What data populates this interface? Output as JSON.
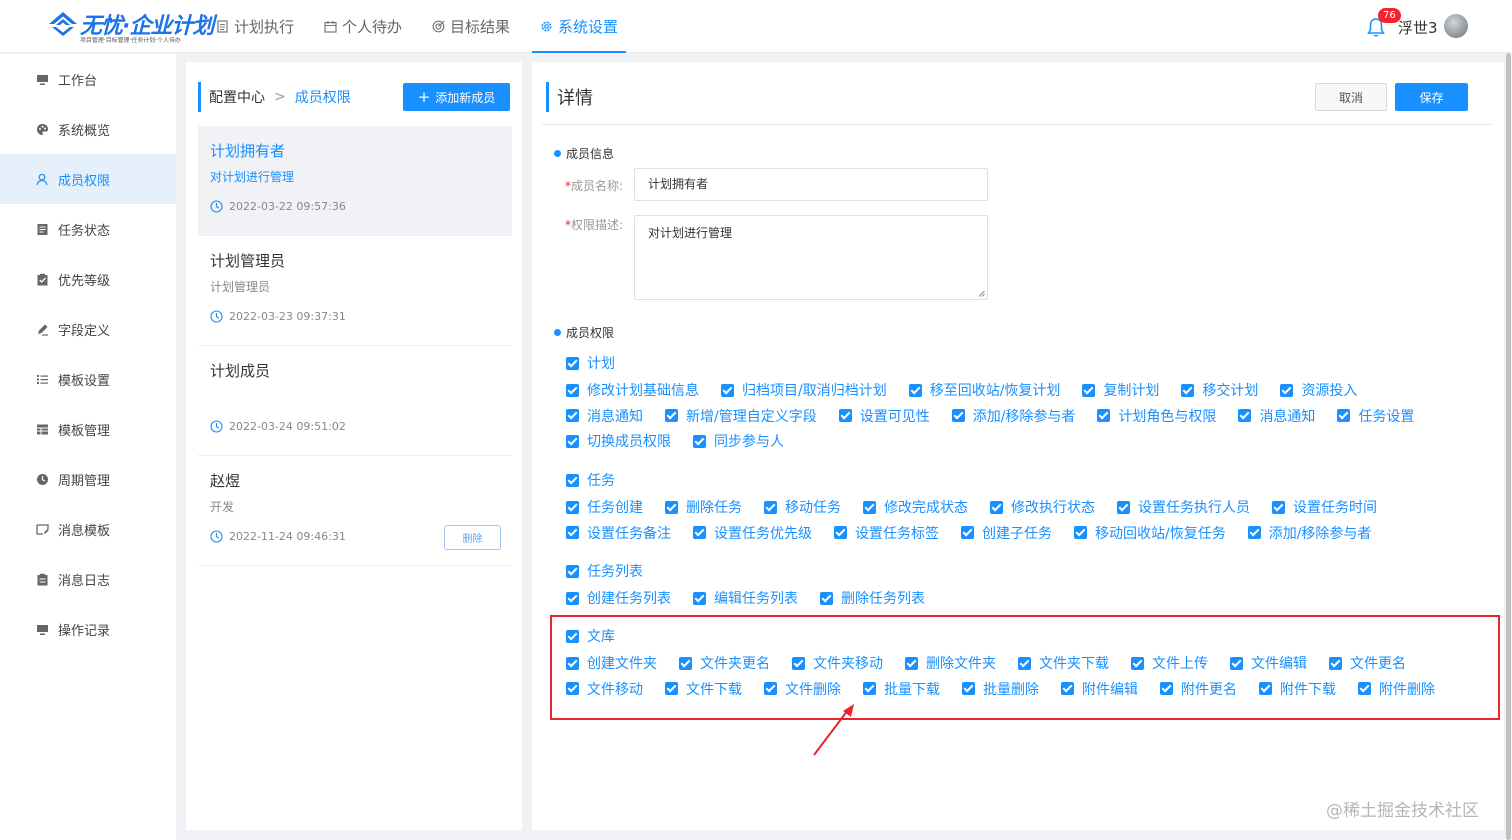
{
  "header": {
    "logo_title": "无忧·企业计划",
    "logo_subtitle": "项目管理·目标管理·任务计划·个人待办",
    "nav": [
      {
        "label": "计划执行",
        "icon": "document-icon",
        "active": false
      },
      {
        "label": "个人待办",
        "icon": "calendar-icon",
        "active": false
      },
      {
        "label": "目标结果",
        "icon": "target-icon",
        "active": false
      },
      {
        "label": "系统设置",
        "icon": "gear-icon",
        "active": true
      }
    ],
    "notification_count": "76",
    "username": "浮世3"
  },
  "sidebar": {
    "items": [
      {
        "label": "工作台",
        "icon": "monitor-icon"
      },
      {
        "label": "系统概览",
        "icon": "palette-icon"
      },
      {
        "label": "成员权限",
        "icon": "user-icon"
      },
      {
        "label": "任务状态",
        "icon": "list-doc-icon"
      },
      {
        "label": "优先等级",
        "icon": "clipboard-check-icon"
      },
      {
        "label": "字段定义",
        "icon": "edit-icon"
      },
      {
        "label": "模板设置",
        "icon": "list-icon"
      },
      {
        "label": "模板管理",
        "icon": "table-icon"
      },
      {
        "label": "周期管理",
        "icon": "clock-icon"
      },
      {
        "label": "消息模板",
        "icon": "message-edit-icon"
      },
      {
        "label": "消息日志",
        "icon": "clipboard-icon"
      },
      {
        "label": "操作记录",
        "icon": "monitor-icon"
      }
    ],
    "active_index": 2
  },
  "middle": {
    "breadcrumb_root": "配置中心",
    "breadcrumb_current": "成员权限",
    "add_button": "添加新成员",
    "cards": [
      {
        "title": "计划拥有者",
        "desc": "对计划进行管理",
        "time": "2022-03-22 09:57:36",
        "active": true
      },
      {
        "title": "计划管理员",
        "desc": "计划管理员",
        "time": "2022-03-23 09:37:31",
        "active": false
      },
      {
        "title": "计划成员",
        "desc": "",
        "time": "2022-03-24 09:51:02",
        "active": false
      },
      {
        "title": "赵煜",
        "desc": "开发",
        "time": "2022-11-24 09:46:31",
        "active": false,
        "delete_label": "删除"
      }
    ]
  },
  "detail": {
    "title": "详情",
    "cancel_label": "取消",
    "save_label": "保存",
    "member_info_heading": "成员信息",
    "name_label": "成员名称:",
    "name_value": "计划拥有者",
    "desc_label": "权限描述:",
    "desc_value": "对计划进行管理",
    "permissions_heading": "成员权限",
    "groups": [
      {
        "head": "计划",
        "rows": [
          [
            "修改计划基础信息",
            "归档项目/取消归档计划",
            "移至回收站/恢复计划",
            "复制计划",
            "移交计划",
            "资源投入"
          ],
          [
            "消息通知",
            "新增/管理自定义字段",
            "设置可见性",
            "添加/移除参与者",
            "计划角色与权限",
            "消息通知",
            "任务设置"
          ],
          [
            "切换成员权限",
            "同步参与人"
          ]
        ]
      },
      {
        "head": "任务",
        "rows": [
          [
            "任务创建",
            "删除任务",
            "移动任务",
            "修改完成状态",
            "修改执行状态",
            "设置任务执行人员",
            "设置任务时间"
          ],
          [
            "设置任务备注",
            "设置任务优先级",
            "设置任务标签",
            "创建子任务",
            "移动回收站/恢复任务",
            "添加/移除参与者"
          ]
        ]
      },
      {
        "head": "任务列表",
        "rows": [
          [
            "创建任务列表",
            "编辑任务列表",
            "删除任务列表"
          ]
        ]
      },
      {
        "head": "文库",
        "rows": [
          [
            "创建文件夹",
            "文件夹更名",
            "文件夹移动",
            "删除文件夹",
            "文件夹下载",
            "文件上传",
            "文件编辑",
            "文件更名"
          ],
          [
            "文件移动",
            "文件下载",
            "文件删除",
            "批量下载",
            "批量删除",
            "附件编辑",
            "附件更名",
            "附件下载",
            "附件删除"
          ]
        ]
      }
    ]
  },
  "watermark": "@稀土掘金技术社区",
  "colors": {
    "accent": "#1890ff",
    "highlight": "#e8252a"
  }
}
